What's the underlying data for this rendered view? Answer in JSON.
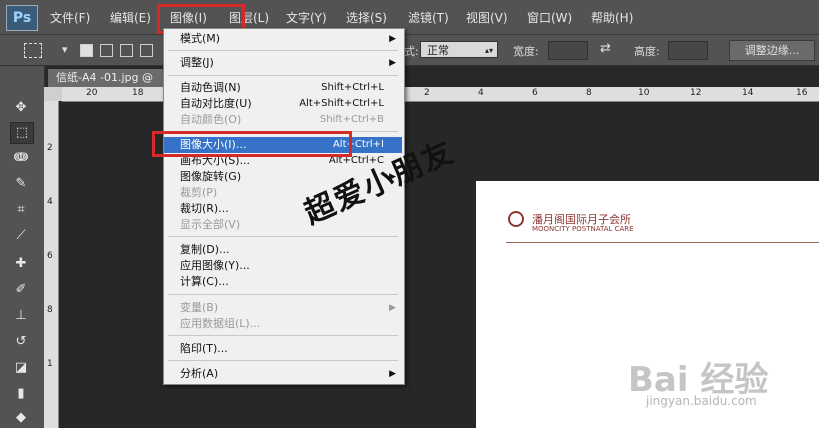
{
  "app": {
    "logo": "Ps"
  },
  "menubar": {
    "items": [
      "文件(F)",
      "编辑(E)",
      "图像(I)",
      "图层(L)",
      "文字(Y)",
      "选择(S)",
      "滤镜(T)",
      "视图(V)",
      "窗口(W)",
      "帮助(H)"
    ],
    "active": "图像(I)"
  },
  "options_bar": {
    "style_label": "式:",
    "style_value": "正常",
    "width_label": "宽度:",
    "height_label": "高度:",
    "refine_button": "调整边缘..."
  },
  "document": {
    "tab": "信纸-A4 -01.jpg @",
    "logo_cn": "潘月阁国际月子会所",
    "logo_en": "MOONCITY POSTNATAL CARE"
  },
  "rulers": {
    "h": [
      "20",
      "18",
      "2",
      "4",
      "6",
      "8",
      "10",
      "12",
      "14",
      "16"
    ],
    "v": [
      "2",
      "4",
      "6",
      "8",
      "1"
    ]
  },
  "image_menu": {
    "items": [
      {
        "label": "模式(M)",
        "submenu": true
      },
      {
        "separator": true
      },
      {
        "label": "调整(J)",
        "submenu": true
      },
      {
        "separator": true
      },
      {
        "label": "自动色调(N)",
        "shortcut": "Shift+Ctrl+L"
      },
      {
        "label": "自动对比度(U)",
        "shortcut": "Alt+Shift+Ctrl+L"
      },
      {
        "label": "自动颜色(O)",
        "shortcut": "Shift+Ctrl+B",
        "disabled": true
      },
      {
        "separator": true
      },
      {
        "label": "图像大小(I)...",
        "shortcut": "Alt+Ctrl+I",
        "selected": true
      },
      {
        "label": "画布大小(S)...",
        "shortcut": "Alt+Ctrl+C"
      },
      {
        "label": "图像旋转(G)",
        "submenu": true
      },
      {
        "label": "裁剪(P)",
        "disabled": true
      },
      {
        "label": "裁切(R)..."
      },
      {
        "label": "显示全部(V)",
        "disabled": true
      },
      {
        "separator": true
      },
      {
        "label": "复制(D)..."
      },
      {
        "label": "应用图像(Y)..."
      },
      {
        "label": "计算(C)..."
      },
      {
        "separator": true
      },
      {
        "label": "变量(B)",
        "submenu": true,
        "disabled": true
      },
      {
        "label": "应用数据组(L)...",
        "disabled": true
      },
      {
        "separator": true
      },
      {
        "label": "陷印(T)..."
      },
      {
        "separator": true
      },
      {
        "label": "分析(A)",
        "submenu": true
      }
    ]
  },
  "overlay": {
    "watermark": "超爱小朋友",
    "baidu": "Bai 经验",
    "baidu_url": "jingyan.baidu.com"
  },
  "colors": {
    "highlight": "#d42a2a",
    "selection": "#3672c8",
    "panel": "#535353",
    "canvas": "#282828"
  }
}
